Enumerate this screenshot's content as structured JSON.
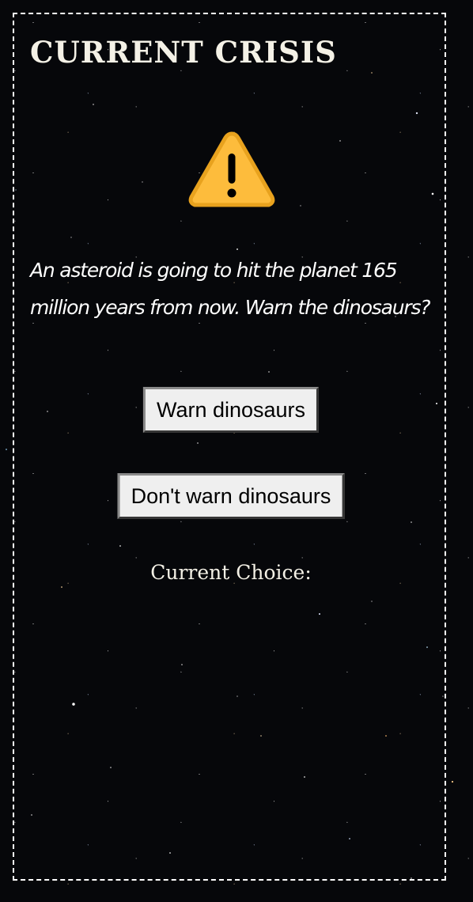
{
  "header": {
    "title": "CURRENT CRISIS"
  },
  "crisis": {
    "icon": "warning-icon",
    "description": "An asteroid is going to hit the planet 165 million years from now. Warn the dinosaurs?"
  },
  "actions": {
    "warn_label": "Warn dinosaurs",
    "dont_warn_label": "Don't warn dinosaurs"
  },
  "status": {
    "current_choice_label": "Current Choice:",
    "current_choice_value": ""
  },
  "colors": {
    "background": "#06070a",
    "text": "#ffffff",
    "warning_fill": "#fdbc3c",
    "warning_stroke": "#e8a21e"
  }
}
